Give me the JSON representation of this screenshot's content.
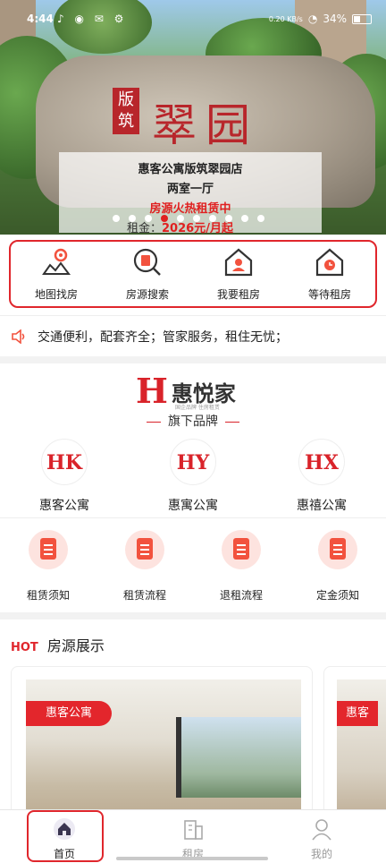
{
  "status_bar": {
    "time": "4:44",
    "battery": "34%",
    "speed": "0.20 KB/s"
  },
  "hero": {
    "sign_tag": "版筑",
    "sign_text": "翠园",
    "overlay": {
      "title": "惠客公寓版筑翠园店",
      "layout": "两室一厅",
      "status": "房源火热租赁中",
      "rent_label": "租金：",
      "rent_value": "2026元/月起"
    },
    "slides": 10,
    "active_slide": 3
  },
  "quick_menu": [
    {
      "label": "地图找房",
      "icon": "map-pin-icon"
    },
    {
      "label": "房源搜索",
      "icon": "search-doc-icon"
    },
    {
      "label": "我要租房",
      "icon": "house-person-icon"
    },
    {
      "label": "等待租房",
      "icon": "house-clock-icon"
    }
  ],
  "notice": {
    "text": "交通便利，配套齐全；管家服务，租住无忧；"
  },
  "brand": {
    "logo_mark": "H",
    "logo_name": "惠悦家",
    "logo_sub": "国企品牌 住房租赁",
    "subtitle": "旗下品牌",
    "apartments": [
      {
        "logo": "HK",
        "label": "惠客公寓"
      },
      {
        "logo": "HY",
        "label": "惠寓公寓"
      },
      {
        "logo": "HX",
        "label": "惠禧公寓"
      }
    ],
    "guides": [
      {
        "label": "租赁须知"
      },
      {
        "label": "租赁流程"
      },
      {
        "label": "退租流程"
      },
      {
        "label": "定金须知"
      }
    ]
  },
  "listings": {
    "hot": "HOT",
    "title": "房源展示",
    "cards": [
      {
        "badge": "惠客公寓"
      },
      {
        "badge": "惠客"
      }
    ]
  },
  "tabbar": [
    {
      "label": "首页",
      "active": true
    },
    {
      "label": "租房",
      "active": false
    },
    {
      "label": "我的",
      "active": false
    }
  ],
  "colors": {
    "accent": "#e0262c",
    "brand_red": "#d9232a"
  }
}
